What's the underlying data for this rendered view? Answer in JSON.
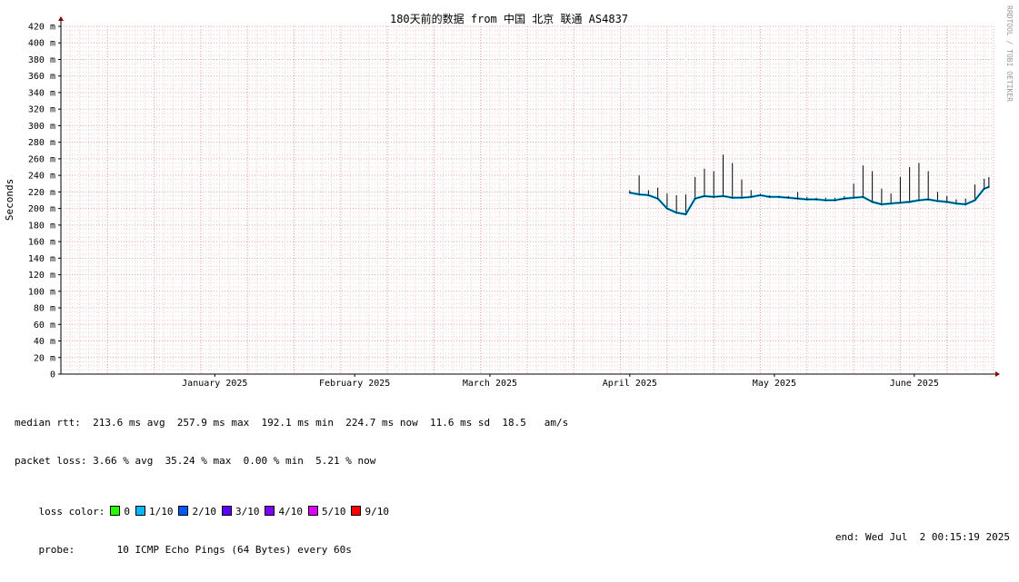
{
  "side_credit": "RRDTOOL / TOBI OETIKER",
  "chart_data": {
    "type": "line",
    "title": "180天前的数据 from 中国 北京 联通 AS4837",
    "ylabel": "Seconds",
    "ylim": [
      0,
      420
    ],
    "yticks": [
      "0",
      "20 m",
      "40 m",
      "60 m",
      "80 m",
      "100 m",
      "120 m",
      "140 m",
      "160 m",
      "180 m",
      "200 m",
      "220 m",
      "240 m",
      "260 m",
      "280 m",
      "300 m",
      "320 m",
      "340 m",
      "360 m",
      "380 m",
      "400 m",
      "420 m"
    ],
    "x_range": [
      "2024-12-14",
      "2025-07-02"
    ],
    "xticks": [
      {
        "label": "January 2025",
        "date": "2025-01-16"
      },
      {
        "label": "February 2025",
        "date": "2025-02-15"
      },
      {
        "label": "March 2025",
        "date": "2025-03-16"
      },
      {
        "label": "April 2025",
        "date": "2025-04-15"
      },
      {
        "label": "May 2025",
        "date": "2025-05-16"
      },
      {
        "label": "June 2025",
        "date": "2025-06-15"
      }
    ],
    "grid": true,
    "series": [
      {
        "x": [
          "2025-04-15",
          "2025-04-17",
          "2025-04-19",
          "2025-04-21",
          "2025-04-23",
          "2025-04-25",
          "2025-04-27",
          "2025-04-29",
          "2025-05-01",
          "2025-05-03",
          "2025-05-05",
          "2025-05-07",
          "2025-05-09",
          "2025-05-11",
          "2025-05-13",
          "2025-05-15",
          "2025-05-17",
          "2025-05-19",
          "2025-05-21",
          "2025-05-23",
          "2025-05-25",
          "2025-05-27",
          "2025-05-29",
          "2025-05-31",
          "2025-06-02",
          "2025-06-04",
          "2025-06-06",
          "2025-06-08",
          "2025-06-10",
          "2025-06-12",
          "2025-06-14",
          "2025-06-16",
          "2025-06-18",
          "2025-06-20",
          "2025-06-22",
          "2025-06-24",
          "2025-06-26",
          "2025-06-28",
          "2025-06-30",
          "2025-07-01"
        ],
        "median_ms": [
          219,
          217,
          216,
          212,
          200,
          195,
          193,
          212,
          215,
          214,
          215,
          213,
          213,
          214,
          216,
          214,
          214,
          213,
          212,
          211,
          211,
          210,
          210,
          212,
          213,
          214,
          208,
          205,
          206,
          207,
          208,
          210,
          211,
          209,
          208,
          206,
          205,
          210,
          224,
          226
        ],
        "spike_ms": [
          222,
          240,
          222,
          225,
          218,
          216,
          217,
          238,
          248,
          245,
          265,
          255,
          235,
          222,
          218,
          216,
          215,
          215,
          220,
          214,
          213,
          213,
          213,
          215,
          230,
          252,
          245,
          224,
          218,
          238,
          250,
          255,
          245,
          220,
          215,
          211,
          212,
          229,
          236,
          238
        ]
      }
    ],
    "loss_colors": [
      {
        "label": "0",
        "color": "#26ff00"
      },
      {
        "label": "1/10",
        "color": "#00b8ff"
      },
      {
        "label": "2/10",
        "color": "#0059ff"
      },
      {
        "label": "3/10",
        "color": "#5e00ff"
      },
      {
        "label": "4/10",
        "color": "#7e00ff"
      },
      {
        "label": "5/10",
        "color": "#dd00ff"
      },
      {
        "label": "9/10",
        "color": "#ff0000"
      }
    ]
  },
  "stats": {
    "median_rtt": "median rtt:  213.6 ms avg  257.9 ms max  192.1 ms min  224.7 ms now  11.6 ms sd  18.5   am/s",
    "packet_loss": "packet loss: 3.66 % avg  35.24 % max  0.00 % min  5.21 % now",
    "loss_color_label": "loss color:",
    "probe": "probe:       10 ICMP Echo Pings (64 Bytes) every 60s",
    "end": "end: Wed Jul  2 00:15:19 2025"
  }
}
